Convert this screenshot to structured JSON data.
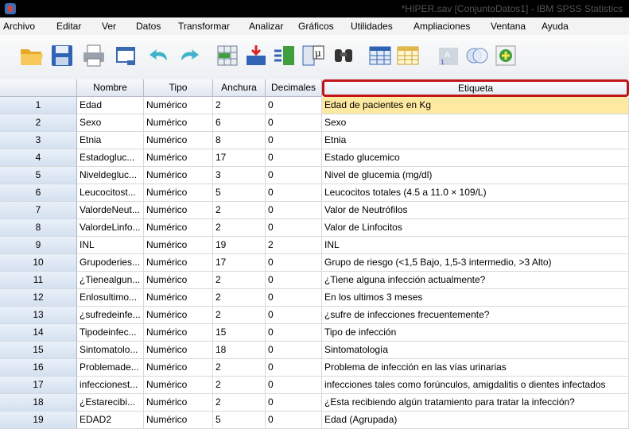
{
  "window": {
    "title": "*HIPER.sav [ConjuntoDatos1] - IBM SPSS Statistics"
  },
  "menu": [
    {
      "label": "Archivo"
    },
    {
      "label": "Editar"
    },
    {
      "label": "Ver"
    },
    {
      "label": "Datos"
    },
    {
      "label": "Transformar"
    },
    {
      "label": "Analizar"
    },
    {
      "label": "Gráficos"
    },
    {
      "label": "Utilidades"
    },
    {
      "label": "Ampliaciones"
    },
    {
      "label": "Ventana"
    },
    {
      "label": "Ayuda"
    }
  ],
  "toolbar": [
    {
      "icon": "open-folder-icon"
    },
    {
      "icon": "save-icon"
    },
    {
      "icon": "print-icon"
    },
    {
      "icon": "dialog-recall-icon"
    },
    {
      "icon": "undo-icon"
    },
    {
      "icon": "redo-icon"
    },
    {
      "icon": "go-to-case-icon"
    },
    {
      "icon": "insert-cases-icon"
    },
    {
      "icon": "insert-variable-icon"
    },
    {
      "icon": "variables-icon"
    },
    {
      "icon": "find-icon"
    },
    {
      "icon": "split-file-icon"
    },
    {
      "icon": "select-cases-icon"
    },
    {
      "icon": "value-labels-icon"
    },
    {
      "icon": "use-sets-icon"
    },
    {
      "icon": "add-icon"
    }
  ],
  "colors": {
    "selected_header_border": "#c0161b",
    "highlight_cell": "#fde9a0"
  },
  "table": {
    "headers": [
      "",
      "Nombre",
      "Tipo",
      "Anchura",
      "Decimales",
      "Etiqueta"
    ],
    "rows": [
      [
        "1",
        "Edad",
        "Numérico",
        "2",
        "0",
        "Edad de pacientes en Kg"
      ],
      [
        "2",
        "Sexo",
        "Numérico",
        "6",
        "0",
        "Sexo"
      ],
      [
        "3",
        "Etnia",
        "Numérico",
        "8",
        "0",
        "Etnia"
      ],
      [
        "4",
        "Estadogluc...",
        "Numérico",
        "17",
        "0",
        "Estado glucemico"
      ],
      [
        "5",
        "Niveldegluc...",
        "Numérico",
        "3",
        "0",
        "Nivel de glucemia (mg/dl)"
      ],
      [
        "6",
        "Leucocitost...",
        "Numérico",
        "5",
        "0",
        "Leucocitos totales (4.5 a 11.0 × 109/L)"
      ],
      [
        "7",
        "ValordeNeut...",
        "Numérico",
        "2",
        "0",
        "Valor de Neutrófilos"
      ],
      [
        "8",
        "ValordeLinfo...",
        "Numérico",
        "2",
        "0",
        "Valor de Linfocitos"
      ],
      [
        "9",
        "INL",
        "Numérico",
        "19",
        "2",
        "INL"
      ],
      [
        "10",
        "Grupoderies...",
        "Numérico",
        "17",
        "0",
        "Grupo de riesgo (<1,5 Bajo, 1,5-3 intermedio, >3 Alto)"
      ],
      [
        "11",
        "¿Tienealgun...",
        "Numérico",
        "2",
        "0",
        "¿Tiene alguna infección actualmente?"
      ],
      [
        "12",
        "Enlosultimo...",
        "Numérico",
        "2",
        "0",
        "En los ultimos 3 meses"
      ],
      [
        "13",
        "¿sufredeinfe...",
        "Numérico",
        "2",
        "0",
        "¿sufre de infecciones frecuentemente?"
      ],
      [
        "14",
        "Tipodeinfec...",
        "Numérico",
        "15",
        "0",
        "Tipo de infección"
      ],
      [
        "15",
        "Sintomatolo...",
        "Numérico",
        "18",
        "0",
        "Sintomatología"
      ],
      [
        "16",
        "Problemade...",
        "Numérico",
        "2",
        "0",
        "Problema de infección en las vías urinarias"
      ],
      [
        "17",
        "infeccionest...",
        "Numérico",
        "2",
        "0",
        "infecciones tales como forúnculos, amigdalitis o dientes infectados"
      ],
      [
        "18",
        "¿Estarecibi...",
        "Numérico",
        "2",
        "0",
        "¿Esta recibiendo algún tratamiento para tratar la infección?"
      ],
      [
        "19",
        "EDAD2",
        "Numérico",
        "5",
        "0",
        "Edad (Agrupada)"
      ]
    ]
  }
}
